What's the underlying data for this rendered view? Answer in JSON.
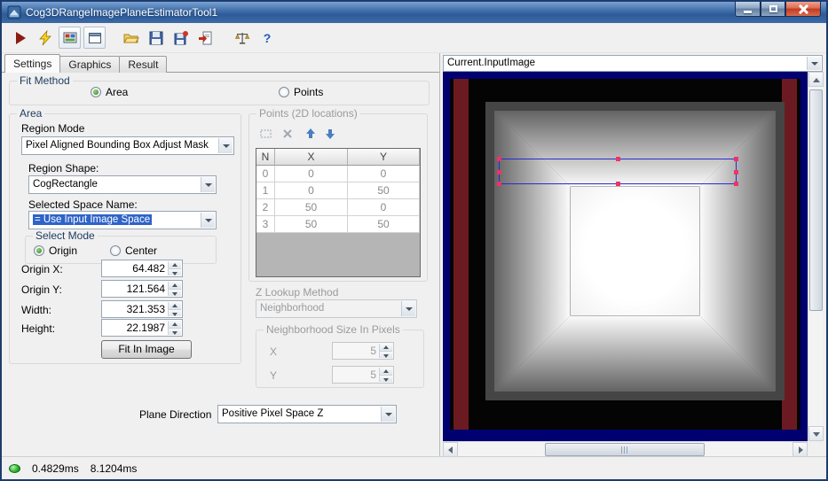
{
  "window": {
    "title": "Cog3DRangeImagePlaneEstimatorTool1"
  },
  "toolbar": {
    "icons": [
      "run-icon",
      "live-run-icon",
      "show-image-icon",
      "float-window-icon",
      "open-file-icon",
      "save-icon",
      "save-image-icon",
      "import-icon",
      "benchmark-icon",
      "help-icon"
    ],
    "help_glyph": "?"
  },
  "tabs": [
    {
      "label": "Settings",
      "active": true
    },
    {
      "label": "Graphics",
      "active": false
    },
    {
      "label": "Result",
      "active": false
    }
  ],
  "settings": {
    "fit_method": {
      "title": "Fit Method",
      "options": [
        {
          "label": "Area",
          "selected": true
        },
        {
          "label": "Points",
          "selected": false
        }
      ]
    },
    "area": {
      "title": "Area",
      "region_mode_label": "Region Mode",
      "region_mode_value": "Pixel Aligned Bounding Box Adjust Mask",
      "region_shape_label": "Region Shape:",
      "region_shape_value": "CogRectangle",
      "selected_space_label": "Selected Space Name:",
      "selected_space_value": "= Use Input Image Space",
      "select_mode": {
        "title": "Select Mode",
        "options": [
          {
            "label": "Origin",
            "selected": true
          },
          {
            "label": "Center",
            "selected": false
          }
        ]
      },
      "fields": [
        {
          "label": "Origin X:",
          "value": "64.482"
        },
        {
          "label": "Origin Y:",
          "value": "121.564"
        },
        {
          "label": "Width:",
          "value": "321.353"
        },
        {
          "label": "Height:",
          "value": "22.1987"
        }
      ],
      "fit_in_image_button": "Fit In Image"
    },
    "points": {
      "title": "Points (2D locations)",
      "toolbar_icons": [
        "add-point-icon",
        "delete-point-icon",
        "move-up-icon",
        "move-down-icon"
      ],
      "table": {
        "columns": [
          "N",
          "X",
          "Y"
        ],
        "rows": [
          [
            "0",
            "0",
            "0"
          ],
          [
            "1",
            "0",
            "50"
          ],
          [
            "2",
            "50",
            "0"
          ],
          [
            "3",
            "50",
            "50"
          ]
        ]
      },
      "z_lookup_label": "Z Lookup Method",
      "z_lookup_value": "Neighborhood",
      "neighborhood": {
        "title": "Neighborhood Size In Pixels",
        "fields": [
          {
            "label": "X",
            "value": "5"
          },
          {
            "label": "Y",
            "value": "5"
          }
        ]
      }
    },
    "plane_direction_label": "Plane Direction",
    "plane_direction_value": "Positive Pixel Space Z"
  },
  "image_panel": {
    "source": "Current.InputImage"
  },
  "status_bar": {
    "run_time": "0.4829ms",
    "total_time": "8.1204ms"
  },
  "colors": {
    "titlebar_blue": "#3d6aa6",
    "selection_highlight_blue": "#2e63c8",
    "selection_rect_blue": "#2a2ad2",
    "handle_pink": "#ee3366",
    "image_border_navy": "#000070",
    "image_bar_red": "#6b1a22",
    "led_green": "#2fb830"
  }
}
